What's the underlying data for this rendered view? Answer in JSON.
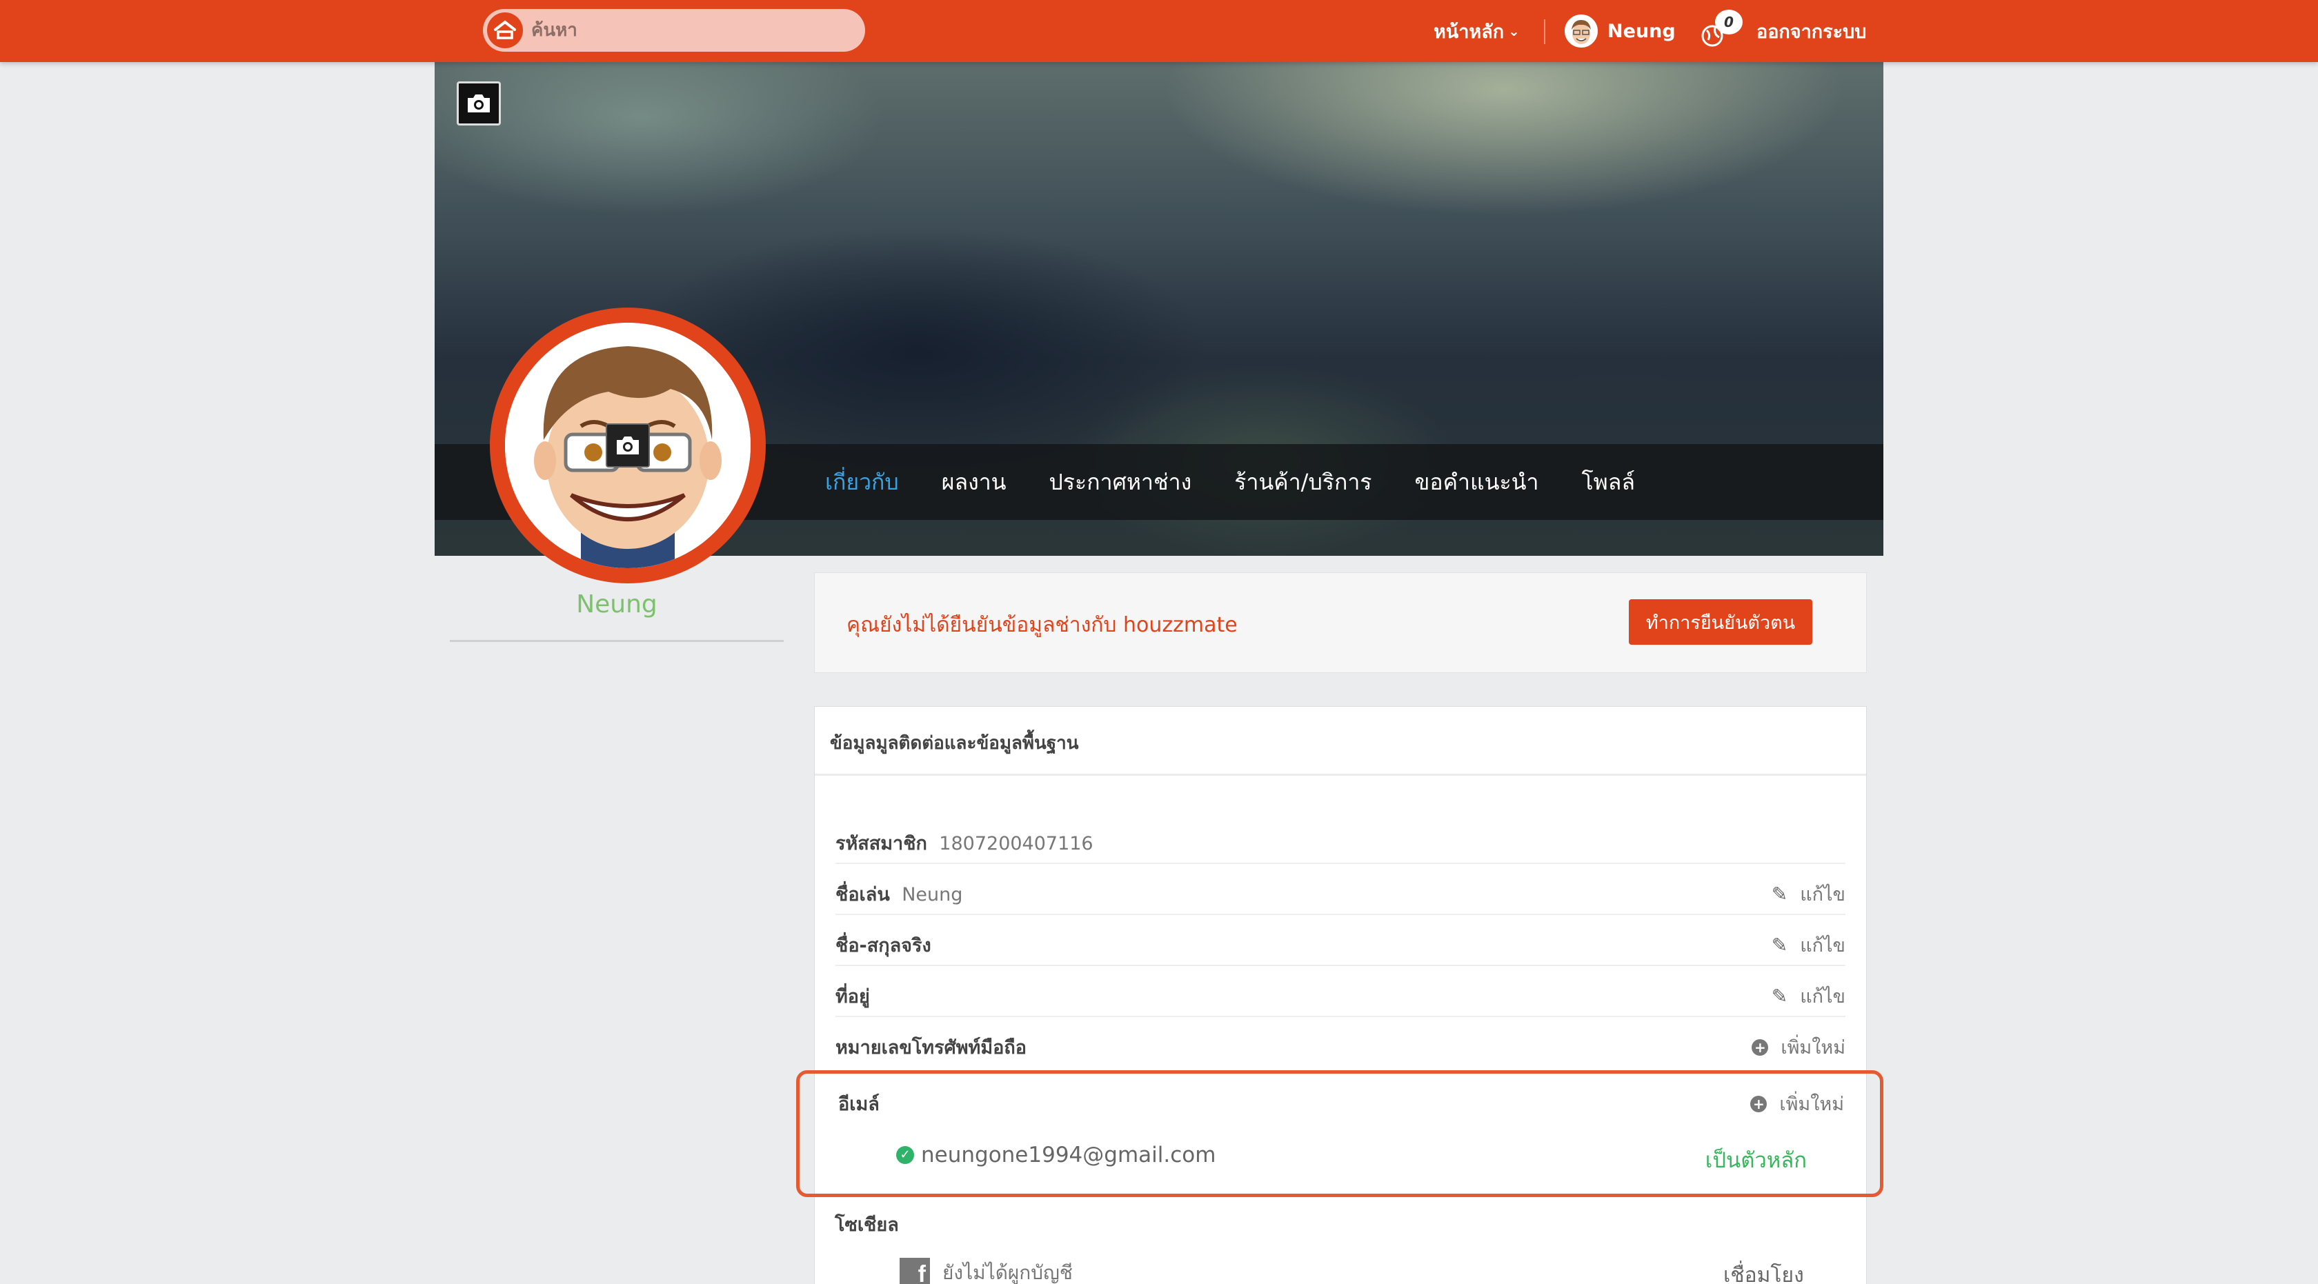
{
  "search": {
    "placeholder": "ค้นหา"
  },
  "nav": {
    "home_label": "หน้าหลัก",
    "user_name": "Neung",
    "notification_count": "0",
    "logout_label": "ออกจากระบบ"
  },
  "profile": {
    "tabs": [
      {
        "label": "เกี่ยวกับ",
        "active": true
      },
      {
        "label": "ผลงาน"
      },
      {
        "label": "ประกาศหาช่าง"
      },
      {
        "label": "ร้านค้า/บริการ"
      },
      {
        "label": "ขอคำแนะนำ"
      },
      {
        "label": "โพลล์"
      }
    ],
    "name": "Neung"
  },
  "verify": {
    "message": "คุณยังไม่ได้ยืนยันข้อมูลช่างกับ houzzmate",
    "button_label": "ทำการยืนยันตัวตน"
  },
  "info": {
    "title": "ข้อมูลมูลติดต่อและข้อมูลพื้นฐาน",
    "rows": [
      {
        "label": "รหัสสมาชิก",
        "value": "1807200407116",
        "action": ""
      },
      {
        "label": "ชื่อเล่น",
        "value": "Neung",
        "action": "แก้ไข"
      },
      {
        "label": "ชื่อ-สกุลจริง",
        "value": "",
        "action": "แก้ไข"
      },
      {
        "label": "ที่อยู่",
        "value": "",
        "action": "แก้ไข"
      },
      {
        "label": "หมายเลขโทรศัพท์มือถือ",
        "value": "",
        "action": "เพิ่มใหม่"
      }
    ],
    "email": {
      "label": "อีเมล์",
      "action": "เพิ่มใหม่",
      "address": "neungone1994@gmail.com",
      "primary_label": "เป็นตัวหลัก"
    },
    "social": {
      "label": "โซเชียล",
      "facebook_status": "ยังไม่ได้ผูกบัญชี",
      "link_label": "เชื่อมโยง"
    }
  },
  "colors": {
    "brand": "#e1431b",
    "active_tab": "#3aa3e3",
    "name_green": "#7cc16c",
    "primary_green": "#35b65a"
  }
}
